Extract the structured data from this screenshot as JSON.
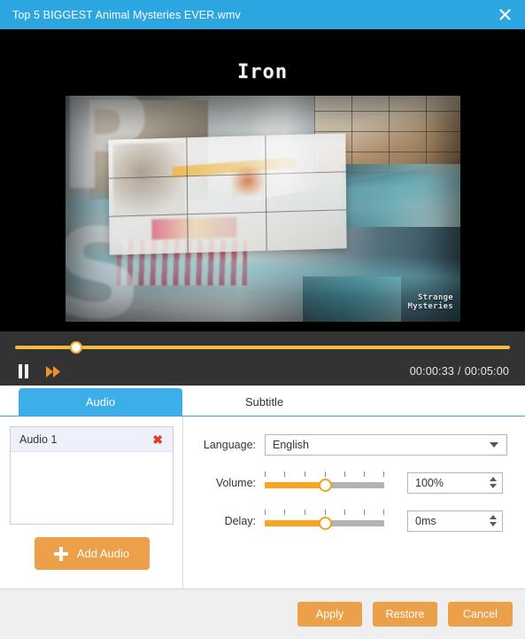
{
  "titlebar": {
    "title": "Top 5 BIGGEST Animal Mysteries EVER.wmv",
    "close_label": "✕",
    "background_color": "#2ba6e0"
  },
  "video": {
    "heading": "Iron",
    "watermark_line1": "Strange",
    "watermark_line2": "Mysteries",
    "big_letter_top": "R",
    "big_letter_bottom": "S"
  },
  "player": {
    "pause_label": "Pause",
    "forward_label": "Fast Forward",
    "current_time": "00:00:33",
    "separator": "/",
    "total_time": "00:05:00",
    "progress_percent": 11,
    "accent_color": "#f5b942"
  },
  "tabs": [
    {
      "label": "Audio",
      "active": true
    },
    {
      "label": "Subtitle",
      "active": false
    }
  ],
  "left_pane": {
    "audio_items": [
      {
        "label": "Audio 1",
        "remove_label": "✖"
      }
    ],
    "add_audio_label": "Add Audio"
  },
  "settings": {
    "language": {
      "label": "Language:",
      "value": "English"
    },
    "volume": {
      "label": "Volume:",
      "value": "100%",
      "slider_percent": 50
    },
    "delay": {
      "label": "Delay:",
      "value": "0ms",
      "slider_percent": 50
    }
  },
  "footer": {
    "apply_label": "Apply",
    "restore_label": "Restore",
    "cancel_label": "Cancel",
    "button_color": "#eda04a"
  }
}
